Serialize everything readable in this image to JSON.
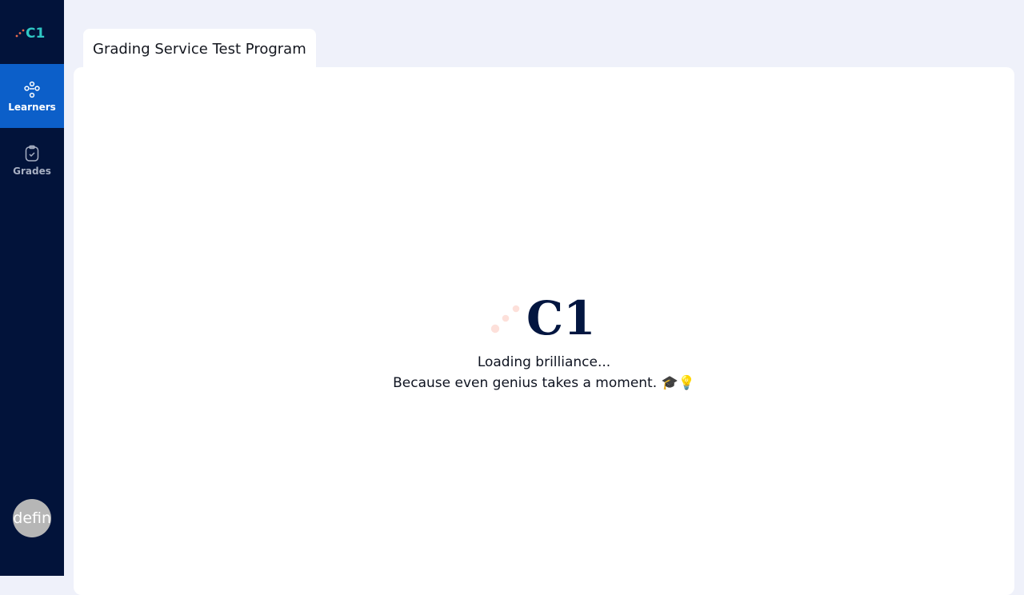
{
  "sidebar": {
    "logo_text": "C1",
    "items": [
      {
        "label": "Learners",
        "icon": "learners-icon",
        "active": true
      },
      {
        "label": "Grades",
        "icon": "clipboard-check-icon",
        "active": false
      }
    ],
    "avatar_text": "undefined"
  },
  "tabs": [
    {
      "label": "Grading Service Test Program",
      "active": true
    }
  ],
  "loader": {
    "logo_text": "C1",
    "line1": "Loading brilliance...",
    "line2": "Because even genius takes a moment. 🎓💡"
  },
  "colors": {
    "sidebar_bg": "#02133a",
    "active_item_bg": "#0c5fc9",
    "logo_dots": "#fde0da",
    "brand_teal": "#2fc7c4",
    "page_bg": "#eff1fa"
  }
}
